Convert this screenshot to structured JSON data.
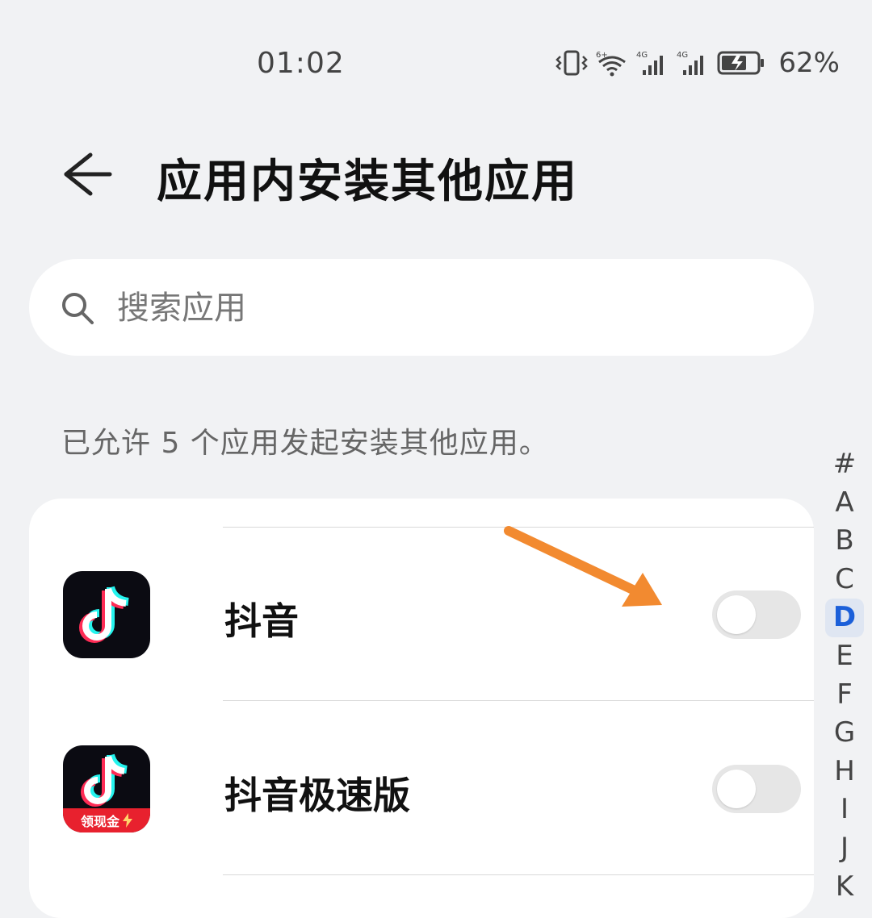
{
  "status_bar": {
    "time": "01:02",
    "battery": "62%",
    "icons": [
      "vibrate-icon",
      "wifi-6-icon",
      "signal-4g-icon",
      "signal-4g-icon",
      "battery-charging-icon"
    ]
  },
  "header": {
    "title": "应用内安装其他应用"
  },
  "search": {
    "placeholder": "搜索应用"
  },
  "info_text": "已允许 5 个应用发起安装其他应用。",
  "apps": [
    {
      "name": "抖音",
      "enabled": false
    },
    {
      "name": "抖音极速版",
      "enabled": false,
      "badge": "领现金"
    }
  ],
  "alpha_index": {
    "letters": [
      "#",
      "A",
      "B",
      "C",
      "D",
      "E",
      "F",
      "G",
      "H",
      "I",
      "J",
      "K"
    ],
    "active": "D"
  },
  "colors": {
    "background": "#f1f2f4",
    "accent": "#1b5fd9",
    "annotation_arrow": "#f28a30"
  }
}
